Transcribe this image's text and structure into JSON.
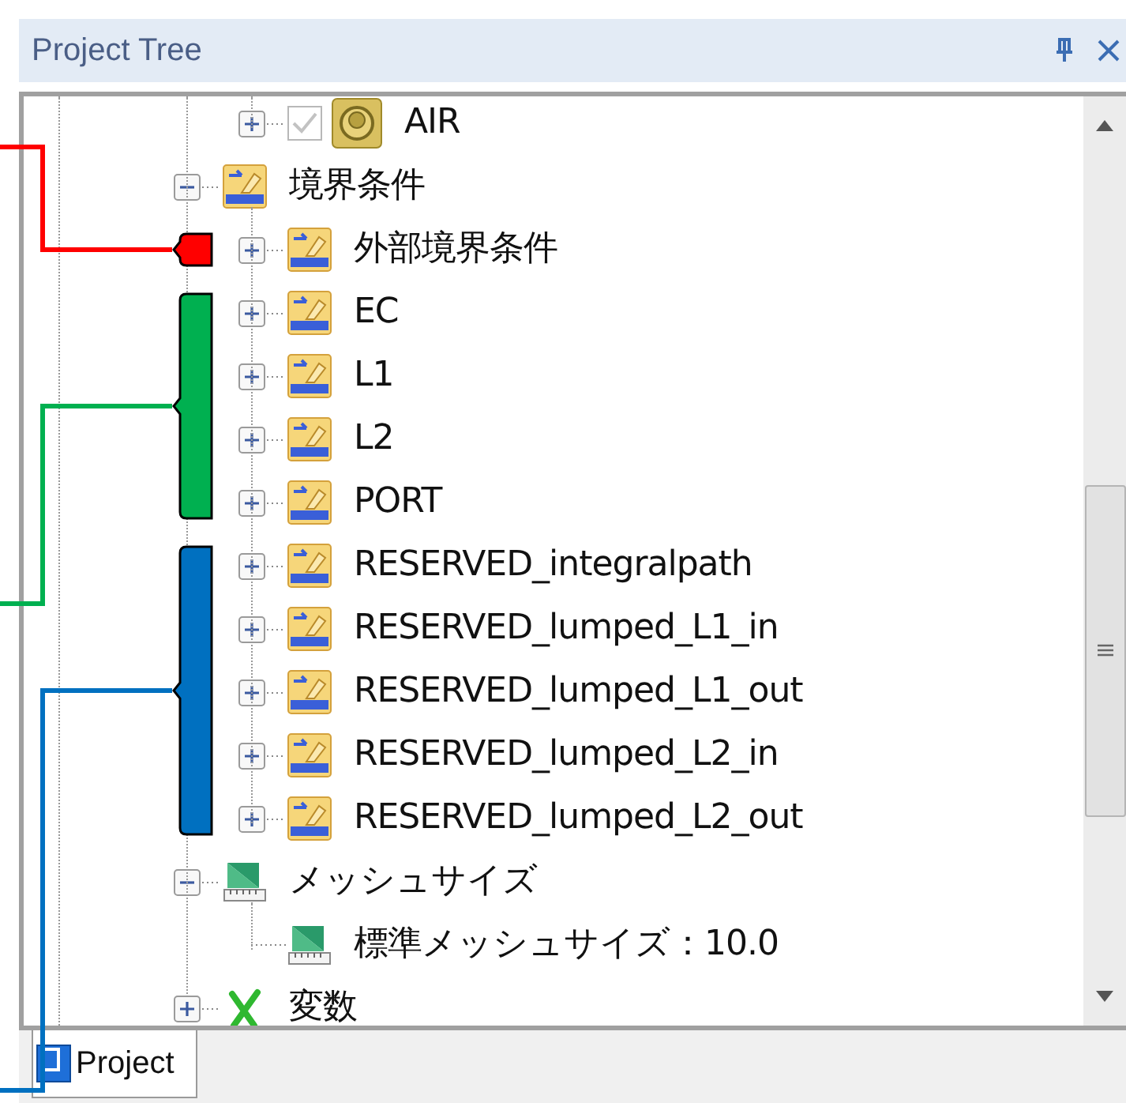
{
  "panel": {
    "title": "Project Tree"
  },
  "tree": {
    "continued_items": [
      {
        "label": "AIR",
        "kind": "material",
        "expanded": false,
        "checked": true
      }
    ],
    "items": [
      {
        "label": "境界条件",
        "kind": "boundary",
        "expanded": true,
        "children": [
          {
            "label": "外部境界条件",
            "kind": "boundary",
            "expanded": false
          },
          {
            "label": "EC",
            "kind": "boundary",
            "expanded": false
          },
          {
            "label": "L1",
            "kind": "boundary",
            "expanded": false
          },
          {
            "label": "L2",
            "kind": "boundary",
            "expanded": false
          },
          {
            "label": "PORT",
            "kind": "boundary",
            "expanded": false
          },
          {
            "label": "RESERVED_integralpath",
            "kind": "boundary",
            "expanded": false
          },
          {
            "label": "RESERVED_lumped_L1_in",
            "kind": "boundary",
            "expanded": false
          },
          {
            "label": "RESERVED_lumped_L1_out",
            "kind": "boundary",
            "expanded": false
          },
          {
            "label": "RESERVED_lumped_L2_in",
            "kind": "boundary",
            "expanded": false
          },
          {
            "label": "RESERVED_lumped_L2_out",
            "kind": "boundary",
            "expanded": false
          }
        ]
      },
      {
        "label": "メッシュサイズ",
        "kind": "mesh",
        "expanded": true,
        "children": [
          {
            "label": "標準メッシュサイズ：10.0",
            "kind": "mesh"
          }
        ]
      },
      {
        "label": "変数",
        "kind": "variable",
        "expanded": false
      }
    ]
  },
  "tabs": [
    {
      "label": "Project",
      "selected": true
    }
  ],
  "annotations": [
    {
      "color": "#ff0000"
    },
    {
      "color": "#00b050"
    },
    {
      "color": "#0070c0"
    }
  ]
}
